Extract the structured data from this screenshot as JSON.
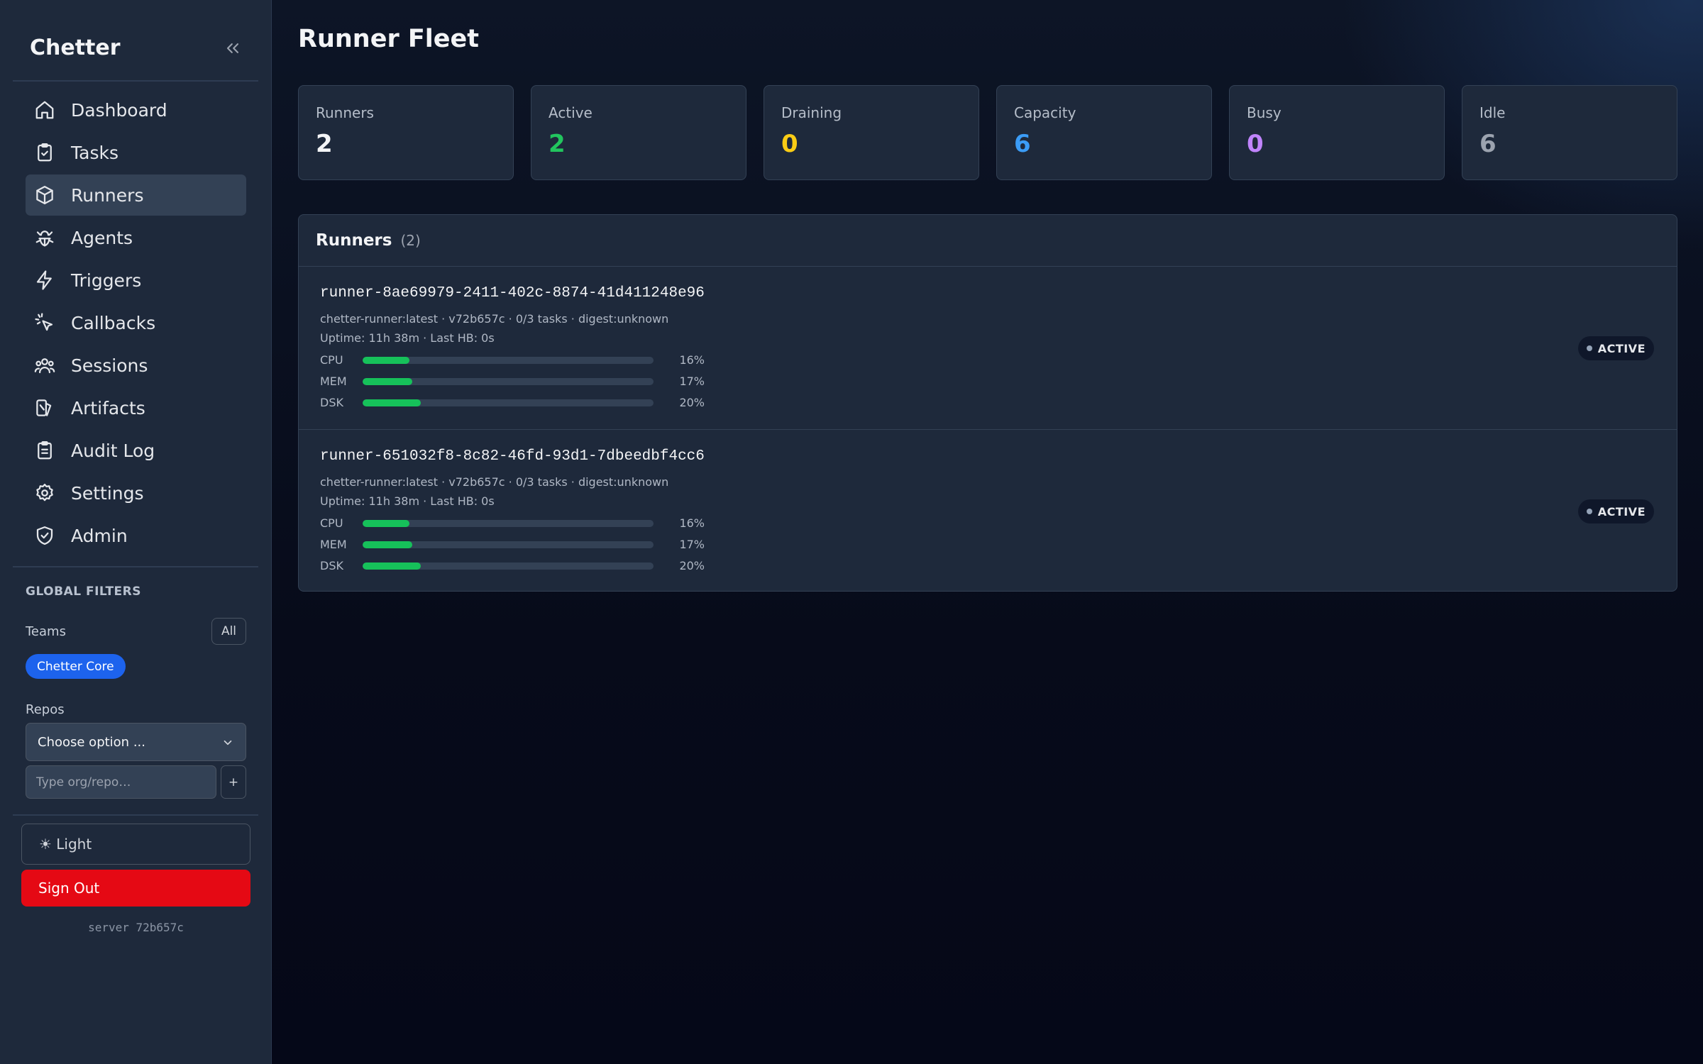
{
  "app": {
    "name": "Chetter"
  },
  "sidebar": {
    "items": [
      {
        "label": "Dashboard",
        "icon": "home-icon",
        "active": false
      },
      {
        "label": "Tasks",
        "icon": "clipboard-check-icon",
        "active": false
      },
      {
        "label": "Runners",
        "icon": "box-icon",
        "active": true
      },
      {
        "label": "Agents",
        "icon": "bug-icon",
        "active": false
      },
      {
        "label": "Triggers",
        "icon": "zap-icon",
        "active": false
      },
      {
        "label": "Callbacks",
        "icon": "pointer-click-icon",
        "active": false
      },
      {
        "label": "Sessions",
        "icon": "users-icon",
        "active": false
      },
      {
        "label": "Artifacts",
        "icon": "shapes-icon",
        "active": false
      },
      {
        "label": "Audit Log",
        "icon": "clipboard-list-icon",
        "active": false
      },
      {
        "label": "Settings",
        "icon": "gear-icon",
        "active": false
      },
      {
        "label": "Admin",
        "icon": "shield-check-icon",
        "active": false
      }
    ],
    "filters": {
      "title": "GLOBAL FILTERS",
      "teams_label": "Teams",
      "all_label": "All",
      "selected_team": "Chetter Core",
      "repos_label": "Repos",
      "repos_select": "Choose option ...",
      "repo_input_placeholder": "Type org/repo…",
      "add_label": "+"
    },
    "theme_label": "☀ Light",
    "signout_label": "Sign Out",
    "server_version": "server 72b657c"
  },
  "page": {
    "title": "Runner Fleet"
  },
  "stats": [
    {
      "label": "Runners",
      "value": "2",
      "color": "#f3f4f6"
    },
    {
      "label": "Active",
      "value": "2",
      "color": "#22c55e"
    },
    {
      "label": "Draining",
      "value": "0",
      "color": "#facc15"
    },
    {
      "label": "Capacity",
      "value": "6",
      "color": "#3b9cf6"
    },
    {
      "label": "Busy",
      "value": "0",
      "color": "#c084fc"
    },
    {
      "label": "Idle",
      "value": "6",
      "color": "#9ca3af"
    }
  ],
  "runners_panel": {
    "title": "Runners",
    "count": "(2)",
    "runners": [
      {
        "name": "runner-8ae69979-2411-402c-8874-41d411248e96",
        "meta": "chetter-runner:latest · v72b657c · 0/3 tasks · digest:unknown",
        "uptime": "Uptime: 11h 38m · Last HB: 0s",
        "status": "ACTIVE",
        "metrics": [
          {
            "label": "CPU",
            "pct": "16%",
            "fraction": 0.16
          },
          {
            "label": "MEM",
            "pct": "17%",
            "fraction": 0.17
          },
          {
            "label": "DSK",
            "pct": "20%",
            "fraction": 0.2
          }
        ]
      },
      {
        "name": "runner-651032f8-8c82-46fd-93d1-7dbeedbf4cc6",
        "meta": "chetter-runner:latest · v72b657c · 0/3 tasks · digest:unknown",
        "uptime": "Uptime: 11h 38m · Last HB: 0s",
        "status": "ACTIVE",
        "metrics": [
          {
            "label": "CPU",
            "pct": "16%",
            "fraction": 0.16
          },
          {
            "label": "MEM",
            "pct": "17%",
            "fraction": 0.17
          },
          {
            "label": "DSK",
            "pct": "20%",
            "fraction": 0.2
          }
        ]
      }
    ]
  }
}
